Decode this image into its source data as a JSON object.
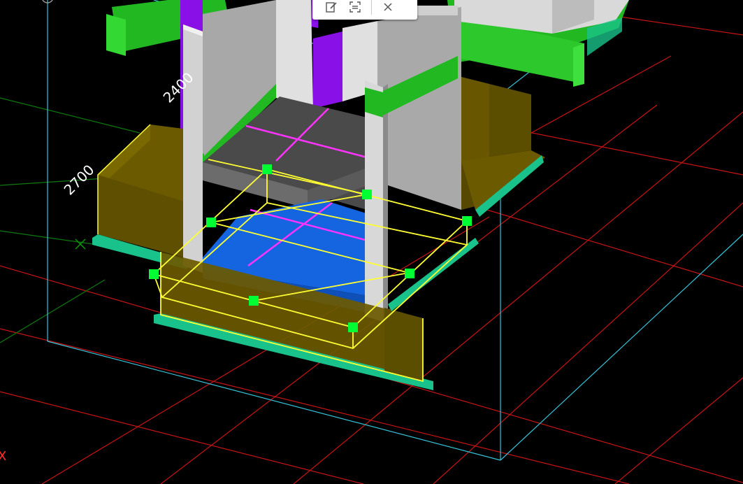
{
  "viewport": {
    "dimensions": [
      "2400",
      "2700"
    ],
    "axis_label": "X"
  },
  "toolbar": {
    "icons": [
      "edit-icon",
      "select-similar-icon",
      "close-icon"
    ]
  },
  "colors": {
    "background": "#000000",
    "grid_red": "#c81414",
    "grid_green": "#0e7a0e",
    "bounding_box": "#35c3d8",
    "selection_outline": "#ffff33",
    "grip": "#00ff33",
    "beam_green": "#22b822",
    "column_gray": "#bdbdbd",
    "slab_blue": "#1565e0",
    "slab_dark": "#4a4a4a",
    "purple_wall": "#8a10e8",
    "foundation_olive": "#6b5a00",
    "cap_teal": "#19c28a",
    "rebar_magenta": "#ff33ff"
  }
}
